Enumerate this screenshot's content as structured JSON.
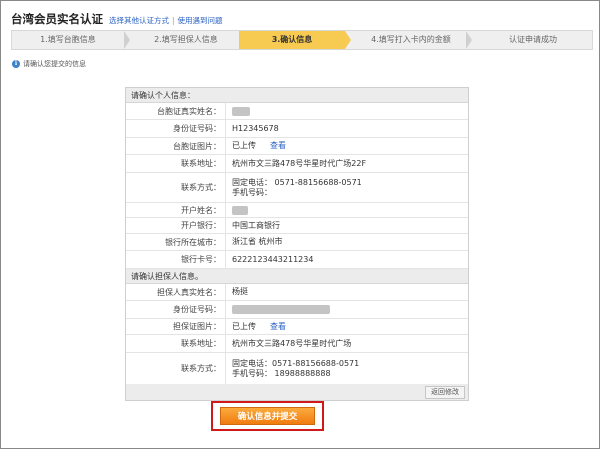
{
  "header": {
    "title": "台湾会员实名认证",
    "alt_method_link": "选择其他认证方式",
    "separator": "|",
    "help_link": "使用遇到问题"
  },
  "steps": [
    {
      "label": "1.填写台胞信息",
      "active": false
    },
    {
      "label": "2.填写担保人信息",
      "active": false
    },
    {
      "label": "3.确认信息",
      "active": true
    },
    {
      "label": "4.填写打入卡内的金额",
      "active": false
    },
    {
      "label": "认证申请成功",
      "active": false
    }
  ],
  "notice": {
    "icon": "info-icon",
    "text": "请确认您提交的信息"
  },
  "personal": {
    "heading": "请确认个人信息：",
    "rows": {
      "name_label": "台胞证真实姓名：",
      "id_label": "身份证号码：",
      "id_value": "H12345678",
      "photo_label": "台胞证图片：",
      "photo_status": "已上传",
      "photo_view": "查看",
      "address_label": "联系地址：",
      "address_value": "杭州市文三路478号华星时代广场22F",
      "contact_label": "联系方式：",
      "phone_value": "固定电话：  0571-88156688-0571",
      "mobile_value": "手机号码：",
      "account_name_label": "开户姓名：",
      "bank_label": "开户银行：",
      "bank_value": "中国工商银行",
      "city_label": "银行所在城市：",
      "city_value": "浙江省  杭州市",
      "card_label": "银行卡号：",
      "card_value": "6222123443211234"
    }
  },
  "guarantor": {
    "heading": "请确认担保人信息。",
    "rows": {
      "name_label": "担保人真实姓名：",
      "name_value": "杨挺",
      "id_label": "身份证号码：",
      "photo_label": "担保证图片：",
      "photo_status": "已上传",
      "photo_view": "查看",
      "address_label": "联系地址：",
      "address_value": "杭州市文三路478号华星时代广场",
      "contact_label": "联系方式：",
      "phone_value": "固定电话：0571-88156688-0571",
      "mobile_value": "手机号码：  18988888888"
    }
  },
  "back_button": "返回修改",
  "submit_button": "确认信息并提交",
  "colors": {
    "active_step": "#f7cb52",
    "link": "#2a62c2",
    "submit": "#f07c10",
    "highlight_border": "#d0191b"
  }
}
